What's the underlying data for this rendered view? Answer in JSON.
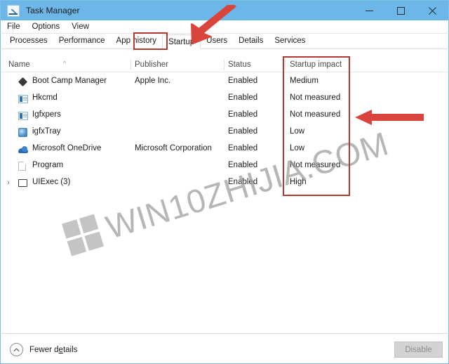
{
  "window": {
    "title": "Task Manager",
    "icon": "task-manager-icon",
    "titlebar_color": "#6cb7e8",
    "controls": {
      "minimize": "minimize-icon",
      "maximize": "maximize-icon",
      "close": "close-icon"
    }
  },
  "menu": {
    "items": [
      {
        "label": "File"
      },
      {
        "label": "Options"
      },
      {
        "label": "View"
      }
    ]
  },
  "tabs": {
    "selected": "Startup",
    "items": [
      {
        "label": "Processes",
        "selected": false
      },
      {
        "label": "Performance",
        "selected": false
      },
      {
        "label": "App history",
        "selected": false
      },
      {
        "label": "Startup",
        "selected": true
      },
      {
        "label": "Users",
        "selected": false
      },
      {
        "label": "Details",
        "selected": false
      },
      {
        "label": "Services",
        "selected": false
      }
    ]
  },
  "table": {
    "columns": [
      {
        "label": "Name",
        "sorted": "ascending",
        "sort_caret": "^"
      },
      {
        "label": "Publisher",
        "sorted": null
      },
      {
        "label": "Status",
        "sorted": null
      },
      {
        "label": "Startup impact",
        "sorted": null
      }
    ],
    "rows": [
      {
        "name": "Boot Camp Manager",
        "publisher": "Apple Inc.",
        "status": "Enabled",
        "impact": "Medium",
        "icon": "diamond-icon",
        "expandable": false,
        "expander": ""
      },
      {
        "name": "Hkcmd",
        "publisher": "",
        "status": "Enabled",
        "impact": "Not measured",
        "icon": "app-window-icon",
        "expandable": false,
        "expander": ""
      },
      {
        "name": "Igfxpers",
        "publisher": "",
        "status": "Enabled",
        "impact": "Not measured",
        "icon": "app-window-icon",
        "expandable": false,
        "expander": ""
      },
      {
        "name": "igfxTray",
        "publisher": "",
        "status": "Enabled",
        "impact": "Low",
        "icon": "tray-icon",
        "expandable": false,
        "expander": ""
      },
      {
        "name": "Microsoft OneDrive",
        "publisher": "Microsoft Corporation",
        "status": "Enabled",
        "impact": "Low",
        "icon": "cloud-icon",
        "expandable": false,
        "expander": ""
      },
      {
        "name": "Program",
        "publisher": "",
        "status": "Enabled",
        "impact": "Not measured",
        "icon": "page-icon",
        "expandable": false,
        "expander": ""
      },
      {
        "name": "UIExec (3)",
        "publisher": "",
        "status": "Enabled",
        "impact": "High",
        "icon": "window-icon",
        "expandable": true,
        "expander": "›"
      }
    ]
  },
  "footer": {
    "fewer_details_label_pre": "Fewer d",
    "fewer_details_accel": "e",
    "fewer_details_label_post": "tails",
    "fewer_details_icon": "chevron-up-circle-icon",
    "disable_button": "Disable",
    "disable_enabled": false
  },
  "annotations": {
    "highlight_color": "#b03a32",
    "arrow_color": "#d9443c",
    "boxes": [
      {
        "target": "startup-tab"
      },
      {
        "target": "startup-impact-column"
      }
    ],
    "arrows": [
      {
        "target": "startup-tab",
        "direction": "down-left"
      },
      {
        "target": "startup-impact-column",
        "direction": "left"
      }
    ]
  },
  "watermark": {
    "text": "WIN10ZHIJIA.COM",
    "logo": "windows-logo",
    "color": "#9a9a9a"
  }
}
